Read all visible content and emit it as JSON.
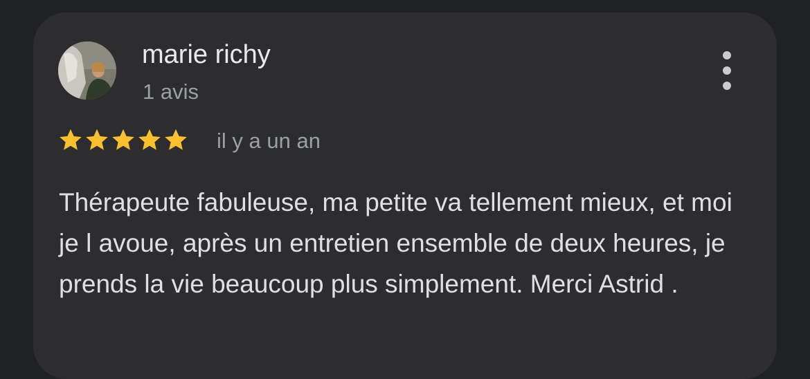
{
  "review": {
    "author_name": "marie richy",
    "review_count": "1 avis",
    "rating": 5,
    "max_rating": 5,
    "date": "il y a un an",
    "text": "Thérapeute fabuleuse, ma petite va tellement mieux, et moi je l avoue, après un entretien ensemble de deux heures, je prends la vie beaucoup plus simplement. Merci Astrid .",
    "more_icon": "more-vert-icon",
    "star_icon": "star-icon"
  },
  "colors": {
    "background": "#202124",
    "card": "#2d2d30",
    "star": "#fbc02d",
    "primary_text": "#e8eaed",
    "secondary_text": "#9aa0a6"
  }
}
